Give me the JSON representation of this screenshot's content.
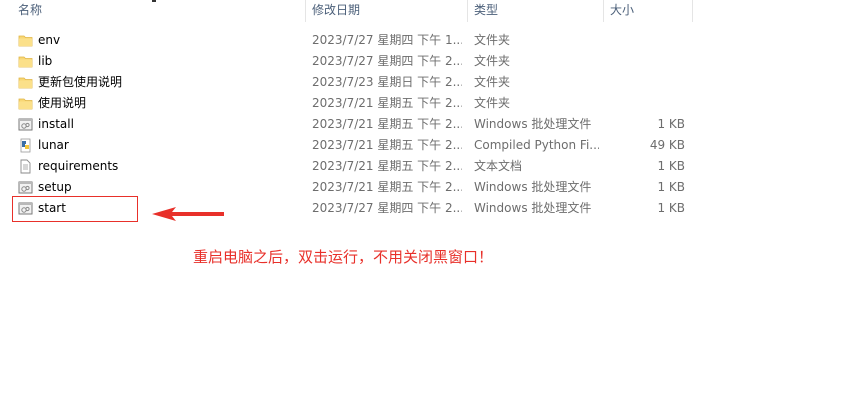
{
  "header": {
    "name": "名称",
    "date": "修改日期",
    "type": "类型",
    "size": "大小"
  },
  "files": [
    {
      "icon": "folder-icon",
      "name": "env",
      "date": "2023/7/27 星期四 下午 1...",
      "type": "文件夹",
      "size": ""
    },
    {
      "icon": "folder-icon",
      "name": "lib",
      "date": "2023/7/27 星期四 下午 2...",
      "type": "文件夹",
      "size": ""
    },
    {
      "icon": "folder-icon",
      "name": "更新包使用说明",
      "date": "2023/7/23 星期日 下午 2...",
      "type": "文件夹",
      "size": ""
    },
    {
      "icon": "folder-icon",
      "name": "使用说明",
      "date": "2023/7/21 星期五 下午 2...",
      "type": "文件夹",
      "size": ""
    },
    {
      "icon": "batch-file-icon",
      "name": "install",
      "date": "2023/7/21 星期五 下午 2...",
      "type": "Windows 批处理文件",
      "size": "1 KB"
    },
    {
      "icon": "python-file-icon",
      "name": "lunar",
      "date": "2023/7/21 星期五 下午 2...",
      "type": "Compiled Python Fi...",
      "size": "49 KB"
    },
    {
      "icon": "text-file-icon",
      "name": "requirements",
      "date": "2023/7/21 星期五 下午 2...",
      "type": "文本文档",
      "size": "1 KB"
    },
    {
      "icon": "batch-file-icon",
      "name": "setup",
      "date": "2023/7/21 星期五 下午 2...",
      "type": "Windows 批处理文件",
      "size": "1 KB"
    },
    {
      "icon": "batch-file-icon",
      "name": "start",
      "date": "2023/7/27 星期四 下午 2...",
      "type": "Windows 批处理文件",
      "size": "1 KB"
    }
  ],
  "annotation": {
    "text": "重启电脑之后，双击运行，不用关闭黑窗口！",
    "color": "#e8302a"
  },
  "colors": {
    "folder": "#f8d775",
    "header_text": "#4c607a",
    "secondary_text": "#6d6d6d"
  }
}
